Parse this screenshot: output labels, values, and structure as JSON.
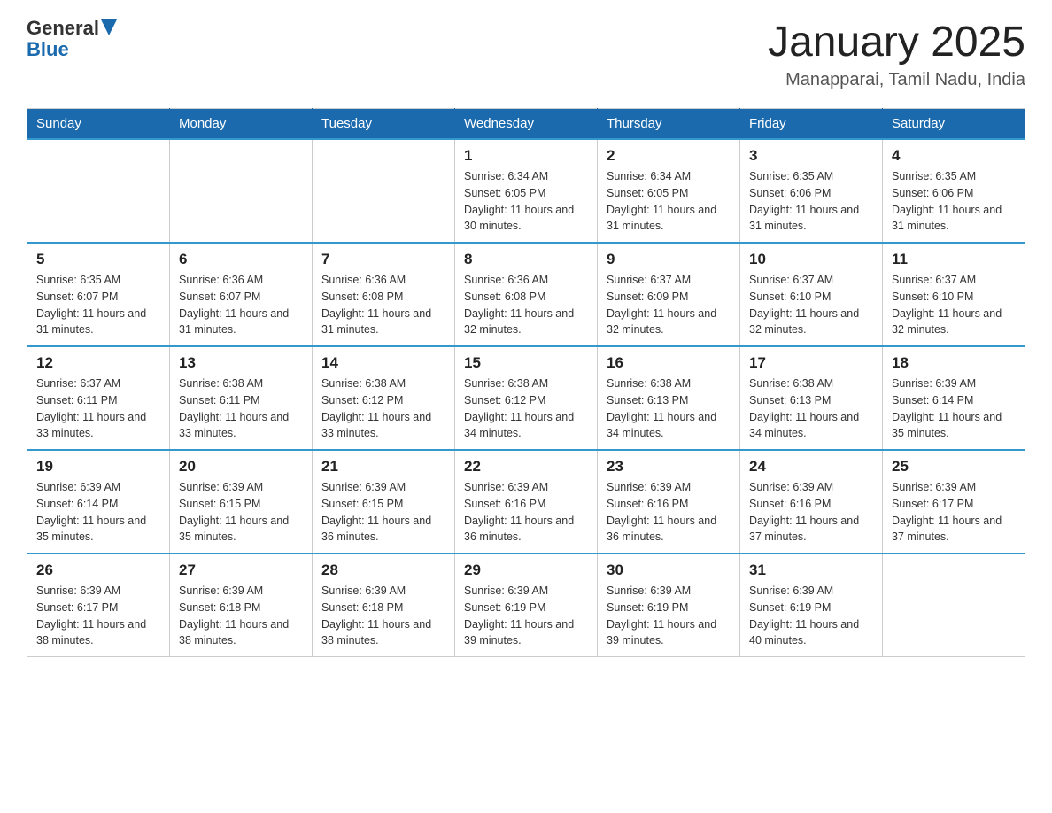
{
  "header": {
    "logo_general": "General",
    "logo_blue": "Blue",
    "month_title": "January 2025",
    "location": "Manapparai, Tamil Nadu, India"
  },
  "days_of_week": [
    "Sunday",
    "Monday",
    "Tuesday",
    "Wednesday",
    "Thursday",
    "Friday",
    "Saturday"
  ],
  "weeks": [
    [
      {
        "day": "",
        "info": ""
      },
      {
        "day": "",
        "info": ""
      },
      {
        "day": "",
        "info": ""
      },
      {
        "day": "1",
        "info": "Sunrise: 6:34 AM\nSunset: 6:05 PM\nDaylight: 11 hours and 30 minutes."
      },
      {
        "day": "2",
        "info": "Sunrise: 6:34 AM\nSunset: 6:05 PM\nDaylight: 11 hours and 31 minutes."
      },
      {
        "day": "3",
        "info": "Sunrise: 6:35 AM\nSunset: 6:06 PM\nDaylight: 11 hours and 31 minutes."
      },
      {
        "day": "4",
        "info": "Sunrise: 6:35 AM\nSunset: 6:06 PM\nDaylight: 11 hours and 31 minutes."
      }
    ],
    [
      {
        "day": "5",
        "info": "Sunrise: 6:35 AM\nSunset: 6:07 PM\nDaylight: 11 hours and 31 minutes."
      },
      {
        "day": "6",
        "info": "Sunrise: 6:36 AM\nSunset: 6:07 PM\nDaylight: 11 hours and 31 minutes."
      },
      {
        "day": "7",
        "info": "Sunrise: 6:36 AM\nSunset: 6:08 PM\nDaylight: 11 hours and 31 minutes."
      },
      {
        "day": "8",
        "info": "Sunrise: 6:36 AM\nSunset: 6:08 PM\nDaylight: 11 hours and 32 minutes."
      },
      {
        "day": "9",
        "info": "Sunrise: 6:37 AM\nSunset: 6:09 PM\nDaylight: 11 hours and 32 minutes."
      },
      {
        "day": "10",
        "info": "Sunrise: 6:37 AM\nSunset: 6:10 PM\nDaylight: 11 hours and 32 minutes."
      },
      {
        "day": "11",
        "info": "Sunrise: 6:37 AM\nSunset: 6:10 PM\nDaylight: 11 hours and 32 minutes."
      }
    ],
    [
      {
        "day": "12",
        "info": "Sunrise: 6:37 AM\nSunset: 6:11 PM\nDaylight: 11 hours and 33 minutes."
      },
      {
        "day": "13",
        "info": "Sunrise: 6:38 AM\nSunset: 6:11 PM\nDaylight: 11 hours and 33 minutes."
      },
      {
        "day": "14",
        "info": "Sunrise: 6:38 AM\nSunset: 6:12 PM\nDaylight: 11 hours and 33 minutes."
      },
      {
        "day": "15",
        "info": "Sunrise: 6:38 AM\nSunset: 6:12 PM\nDaylight: 11 hours and 34 minutes."
      },
      {
        "day": "16",
        "info": "Sunrise: 6:38 AM\nSunset: 6:13 PM\nDaylight: 11 hours and 34 minutes."
      },
      {
        "day": "17",
        "info": "Sunrise: 6:38 AM\nSunset: 6:13 PM\nDaylight: 11 hours and 34 minutes."
      },
      {
        "day": "18",
        "info": "Sunrise: 6:39 AM\nSunset: 6:14 PM\nDaylight: 11 hours and 35 minutes."
      }
    ],
    [
      {
        "day": "19",
        "info": "Sunrise: 6:39 AM\nSunset: 6:14 PM\nDaylight: 11 hours and 35 minutes."
      },
      {
        "day": "20",
        "info": "Sunrise: 6:39 AM\nSunset: 6:15 PM\nDaylight: 11 hours and 35 minutes."
      },
      {
        "day": "21",
        "info": "Sunrise: 6:39 AM\nSunset: 6:15 PM\nDaylight: 11 hours and 36 minutes."
      },
      {
        "day": "22",
        "info": "Sunrise: 6:39 AM\nSunset: 6:16 PM\nDaylight: 11 hours and 36 minutes."
      },
      {
        "day": "23",
        "info": "Sunrise: 6:39 AM\nSunset: 6:16 PM\nDaylight: 11 hours and 36 minutes."
      },
      {
        "day": "24",
        "info": "Sunrise: 6:39 AM\nSunset: 6:16 PM\nDaylight: 11 hours and 37 minutes."
      },
      {
        "day": "25",
        "info": "Sunrise: 6:39 AM\nSunset: 6:17 PM\nDaylight: 11 hours and 37 minutes."
      }
    ],
    [
      {
        "day": "26",
        "info": "Sunrise: 6:39 AM\nSunset: 6:17 PM\nDaylight: 11 hours and 38 minutes."
      },
      {
        "day": "27",
        "info": "Sunrise: 6:39 AM\nSunset: 6:18 PM\nDaylight: 11 hours and 38 minutes."
      },
      {
        "day": "28",
        "info": "Sunrise: 6:39 AM\nSunset: 6:18 PM\nDaylight: 11 hours and 38 minutes."
      },
      {
        "day": "29",
        "info": "Sunrise: 6:39 AM\nSunset: 6:19 PM\nDaylight: 11 hours and 39 minutes."
      },
      {
        "day": "30",
        "info": "Sunrise: 6:39 AM\nSunset: 6:19 PM\nDaylight: 11 hours and 39 minutes."
      },
      {
        "day": "31",
        "info": "Sunrise: 6:39 AM\nSunset: 6:19 PM\nDaylight: 11 hours and 40 minutes."
      },
      {
        "day": "",
        "info": ""
      }
    ]
  ]
}
